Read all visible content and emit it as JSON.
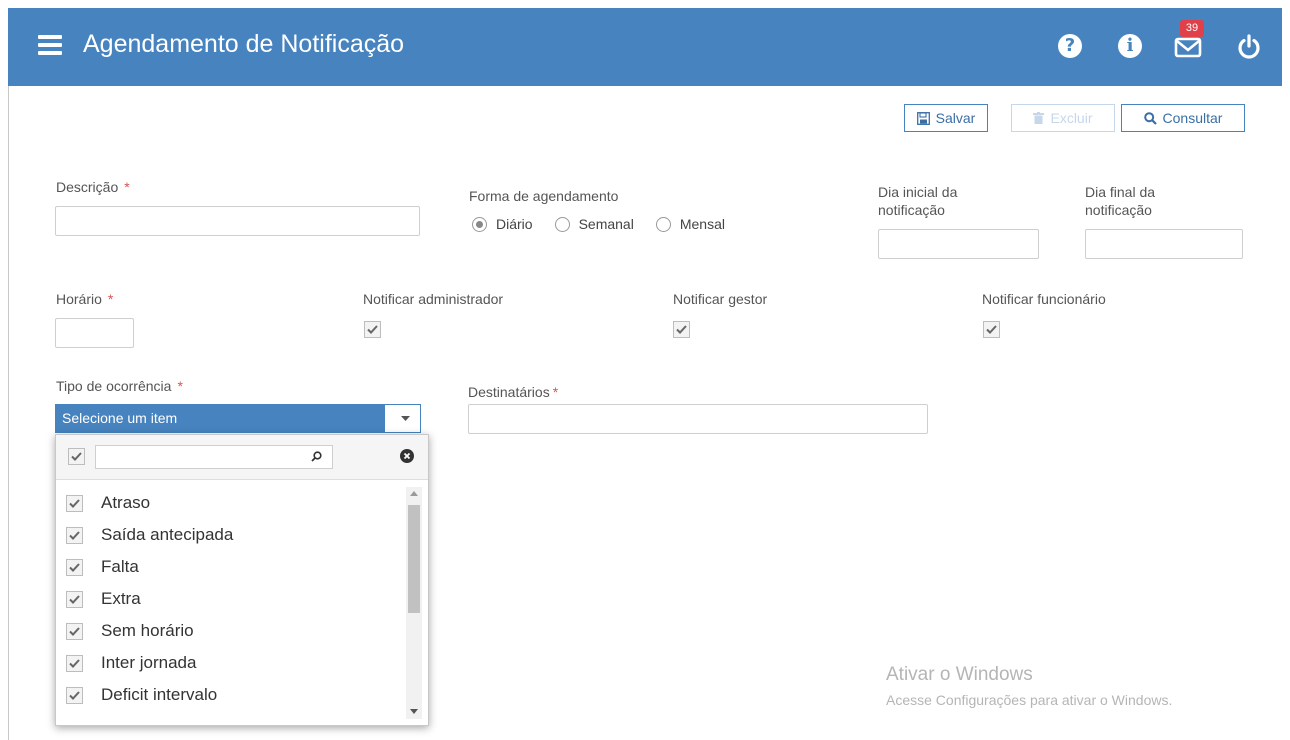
{
  "header": {
    "title": "Agendamento de Notificação",
    "help_glyph": "?",
    "info_glyph": "i",
    "mail_badge": "39",
    "icons": [
      "menu-icon",
      "help-icon",
      "info-icon",
      "mail-icon",
      "power-icon"
    ],
    "bg_color": "#4683bf"
  },
  "toolbar": {
    "save_label": "Salvar",
    "delete_label": "Excluir",
    "query_label": "Consultar"
  },
  "form": {
    "descricao": {
      "label": "Descrição",
      "required": "*",
      "value": ""
    },
    "forma": {
      "label": "Forma de agendamento",
      "options": [
        "Diário",
        "Semanal",
        "Mensal"
      ],
      "selected": "Diário"
    },
    "dia_inicial": {
      "label_line1": "Dia inicial da",
      "label_line2": "notificação",
      "value": ""
    },
    "dia_final": {
      "label_line1": "Dia final da",
      "label_line2": "notificação",
      "value": ""
    },
    "horario": {
      "label": "Horário",
      "required": "*",
      "value": ""
    },
    "notificar_admin": {
      "label": "Notificar administrador",
      "checked": true
    },
    "notificar_gestor": {
      "label": "Notificar gestor",
      "checked": true
    },
    "notificar_func": {
      "label": "Notificar funcionário",
      "checked": true
    },
    "tipo": {
      "label": "Tipo de ocorrência",
      "required": "*",
      "value": "Selecione um item"
    },
    "destinatarios": {
      "label": "Destinatários",
      "required": "*",
      "value": ""
    }
  },
  "dropdown": {
    "search_value": "",
    "select_all_checked": true,
    "items": [
      {
        "label": "Atraso",
        "checked": true
      },
      {
        "label": "Saída antecipada",
        "checked": true
      },
      {
        "label": "Falta",
        "checked": true
      },
      {
        "label": "Extra",
        "checked": true
      },
      {
        "label": "Sem horário",
        "checked": true
      },
      {
        "label": "Inter jornada",
        "checked": true
      },
      {
        "label": "Deficit intervalo",
        "checked": true
      }
    ]
  },
  "watermark": {
    "title": "Ativar o Windows",
    "subtitle": "Acesse Configurações para ativar o Windows."
  }
}
